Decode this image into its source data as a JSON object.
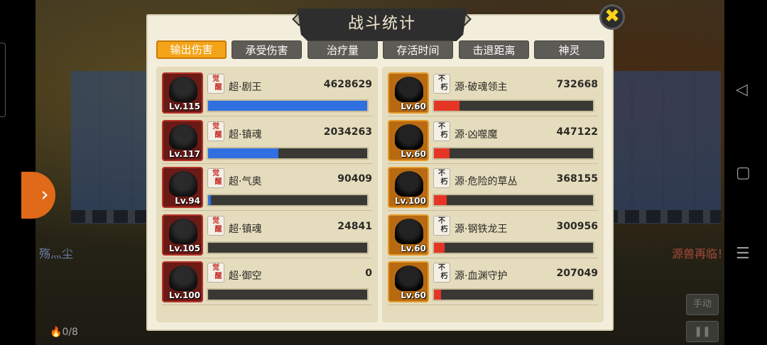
{
  "background": {
    "left_label": "殇灬尘",
    "right_label": "源兽再临！",
    "resource": {
      "count": "0/8"
    },
    "manual_label": "手动",
    "pause_label": "❚❚"
  },
  "system_nav": {
    "back": "◁",
    "home": "▢",
    "menu": "☰"
  },
  "modal": {
    "title": "战斗统计",
    "close_icon": "✖",
    "tabs": [
      {
        "label": "输出伤害",
        "active": true
      },
      {
        "label": "承受伤害",
        "active": false
      },
      {
        "label": "治疗量",
        "active": false
      },
      {
        "label": "存活时间",
        "active": false
      },
      {
        "label": "击退距离",
        "active": false
      },
      {
        "label": "神灵",
        "active": false
      }
    ],
    "left_team": [
      {
        "badge": [
          "觉",
          "醒"
        ],
        "name": "超·剧王",
        "level": "Lv.115",
        "value": "4628629",
        "bar_fraction": 1.0
      },
      {
        "badge": [
          "觉",
          "醒"
        ],
        "name": "超·镇魂",
        "level": "Lv.117",
        "value": "2034263",
        "bar_fraction": 0.44
      },
      {
        "badge": [
          "觉",
          "醒"
        ],
        "name": "超·气奥",
        "level": "Lv.94",
        "value": "90409",
        "bar_fraction": 0.02
      },
      {
        "badge": [
          "觉",
          "醒"
        ],
        "name": "超·镇魂",
        "level": "Lv.105",
        "value": "24841",
        "bar_fraction": 0.0
      },
      {
        "badge": [
          "觉",
          "醒"
        ],
        "name": "超·御空",
        "level": "Lv.100",
        "value": "0",
        "bar_fraction": 0.0
      }
    ],
    "right_team": [
      {
        "badge": [
          "不",
          "朽"
        ],
        "name": "源·破魂领主",
        "level": "Lv.60",
        "value": "732668",
        "bar_fraction": 0.16
      },
      {
        "badge": [
          "不",
          "朽"
        ],
        "name": "源·凶噬魔",
        "level": "Lv.60",
        "value": "447122",
        "bar_fraction": 0.1
      },
      {
        "badge": [
          "不",
          "朽"
        ],
        "name": "源·危险的草丛",
        "level": "Lv.100",
        "value": "368155",
        "bar_fraction": 0.08
      },
      {
        "badge": [
          "不",
          "朽"
        ],
        "name": "源·钢铁龙王",
        "level": "Lv.60",
        "value": "300956",
        "bar_fraction": 0.065
      },
      {
        "badge": [
          "不",
          "朽"
        ],
        "name": "源·血渊守护",
        "level": "Lv.60",
        "value": "207049",
        "bar_fraction": 0.045
      }
    ]
  }
}
